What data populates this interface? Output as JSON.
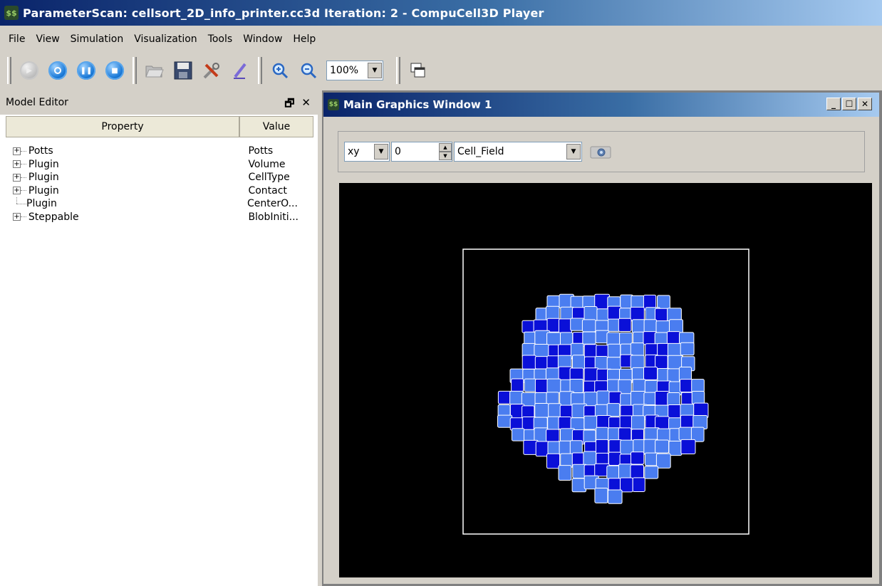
{
  "window": {
    "title": "ParameterScan: cellsort_2D_info_printer.cc3d Iteration: 2 - CompuCell3D Player",
    "icon": "cc3d-app-icon"
  },
  "menu": [
    "File",
    "View",
    "Simulation",
    "Visualization",
    "Tools",
    "Window",
    "Help"
  ],
  "toolbar": {
    "zoom_value": "100%",
    "buttons": [
      "run",
      "step",
      "pause",
      "stop",
      "open",
      "save",
      "configuration",
      "edit-xml",
      "zoom-in",
      "zoom-out",
      "cascade-windows"
    ]
  },
  "model_editor": {
    "title": "Model Editor",
    "columns": {
      "property": "Property",
      "value": "Value"
    },
    "rows": [
      {
        "property": "Potts",
        "value": "Potts",
        "expandable": true
      },
      {
        "property": "Plugin",
        "value": "Volume",
        "expandable": true
      },
      {
        "property": "Plugin",
        "value": "CellType",
        "expandable": true
      },
      {
        "property": "Plugin",
        "value": "Contact",
        "expandable": true
      },
      {
        "property": "Plugin",
        "value": "CenterO...",
        "expandable": false
      },
      {
        "property": "Steppable",
        "value": "BlobIniti...",
        "expandable": true
      }
    ]
  },
  "graphics_window": {
    "title": "Main Graphics Window 1",
    "plane": "xy",
    "slice": "0",
    "field": "Cell_Field",
    "cell_colors": {
      "light": "#4a7df0",
      "dark": "#0a10d8",
      "border": "#ffffff"
    }
  }
}
